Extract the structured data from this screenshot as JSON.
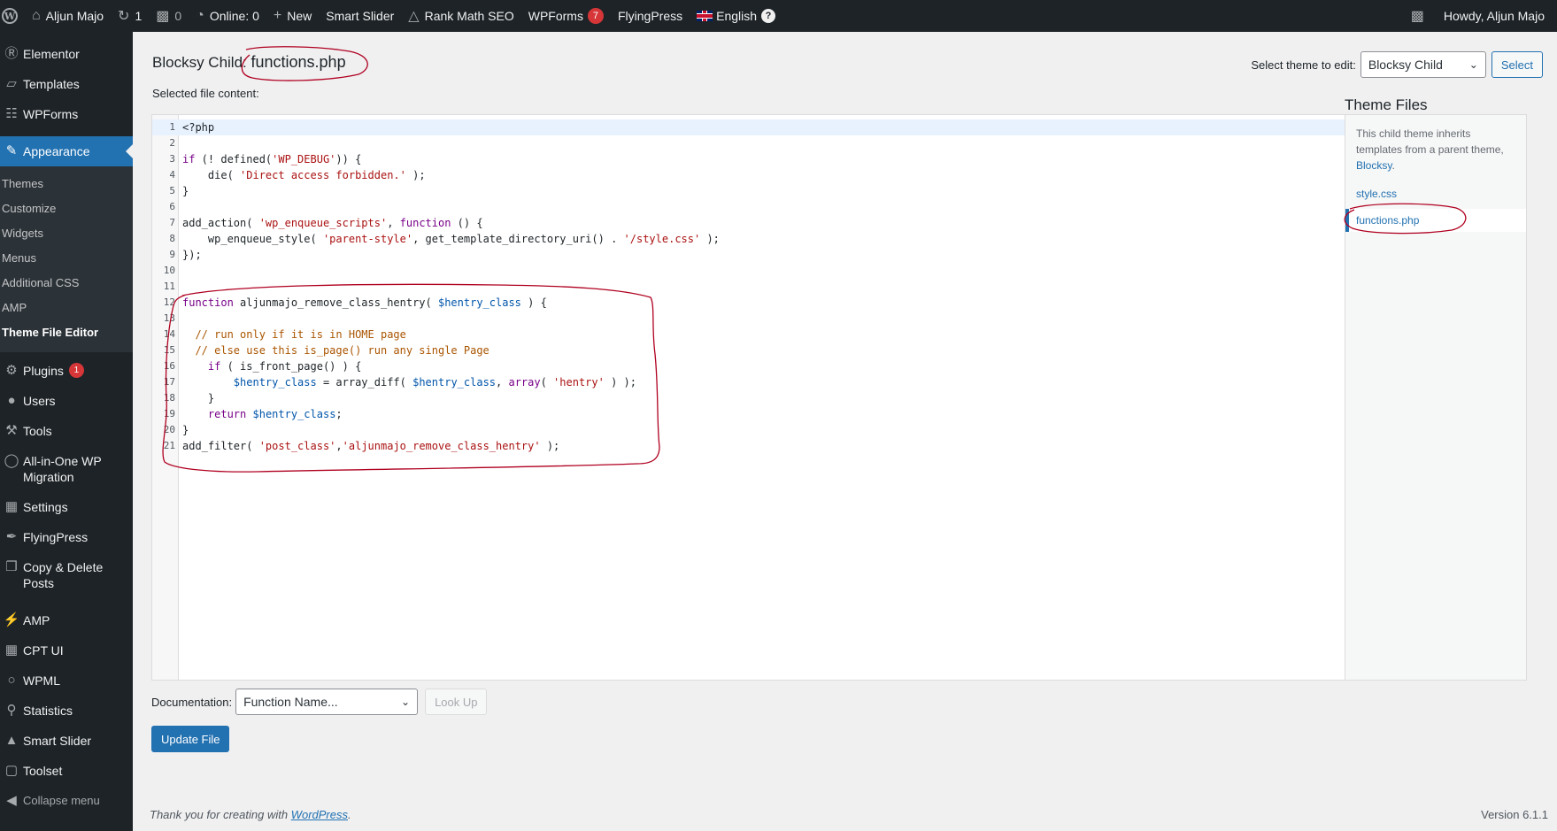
{
  "adminbar": {
    "site_name": "Aljun Majo",
    "updates_count": "1",
    "comments_count": "0",
    "online": "Online: 0",
    "new": "New",
    "smart_slider": "Smart Slider",
    "rank_math": "Rank Math SEO",
    "wpforms": "WPForms",
    "wpforms_count": "7",
    "flyingpress": "FlyingPress",
    "language": "English",
    "help": "?",
    "howdy": "Howdy, Aljun Majo"
  },
  "sidebar": {
    "top_items": [
      {
        "label": "Elementor",
        "icon": "elementor-icon",
        "glyph": "Ⓔ"
      },
      {
        "label": "Templates",
        "icon": "folder-icon",
        "glyph": "▱"
      },
      {
        "label": "WPForms",
        "icon": "forms-icon",
        "glyph": "☷"
      }
    ],
    "appearance": "Appearance",
    "submenu": [
      "Themes",
      "Customize",
      "Widgets",
      "Menus",
      "Additional CSS",
      "AMP",
      "Theme File Editor"
    ],
    "plugins": "Plugins",
    "plugins_count": "1",
    "users": "Users",
    "tools": "Tools",
    "all_in_one": "All-in-One WP Migration",
    "settings": "Settings",
    "flyingpress": "FlyingPress",
    "copy_delete": "Copy & Delete Posts",
    "amp": "AMP",
    "cpt_ui": "CPT UI",
    "wpml": "WPML",
    "statistics": "Statistics",
    "smart_slider": "Smart Slider",
    "toolset": "Toolset",
    "collapse": "Collapse menu"
  },
  "header": {
    "title_prefix": "Blocksy Child:",
    "filename": "functions.php",
    "selected_file_content": "Selected file content:",
    "select_theme_label": "Select theme to edit:",
    "selected_theme": "Blocksy Child",
    "select_button": "Select"
  },
  "editor": {
    "lines": [
      "<?php",
      "",
      "if (! defined('WP_DEBUG')) {",
      "    die( 'Direct access forbidden.' );",
      "}",
      "",
      "add_action( 'wp_enqueue_scripts', function () {",
      "    wp_enqueue_style( 'parent-style', get_template_directory_uri() . '/style.css' );",
      "});",
      "",
      "",
      "function aljunmajo_remove_class_hentry( $hentry_class ) {",
      "",
      "  // run only if it is in HOME page",
      "  // else use this is_page() run any single Page",
      "    if ( is_front_page() ) {",
      "        $hentry_class = array_diff( $hentry_class, array( 'hentry' ) );",
      "    }",
      "    return $hentry_class;",
      "}",
      "add_filter( 'post_class','aljunmajo_remove_class_hentry' );"
    ]
  },
  "theme_files": {
    "title": "Theme Files",
    "desc_text": "This child theme inherits templates from a parent theme,",
    "desc_link": "Blocksy",
    "desc_end": ".",
    "files": [
      "style.css",
      "functions.php"
    ]
  },
  "documentation": {
    "label": "Documentation:",
    "placeholder": "Function Name...",
    "lookup": "Look Up"
  },
  "update_button": "Update File",
  "footer": {
    "thanks": "Thank you for creating with",
    "link": "WordPress",
    "thanks_end": ".",
    "version": "Version 6.1.1"
  },
  "colors": {
    "adminbar_bg": "#1d2327",
    "accent": "#2271b1",
    "badge": "#d63638",
    "annotation": "#b00020"
  }
}
